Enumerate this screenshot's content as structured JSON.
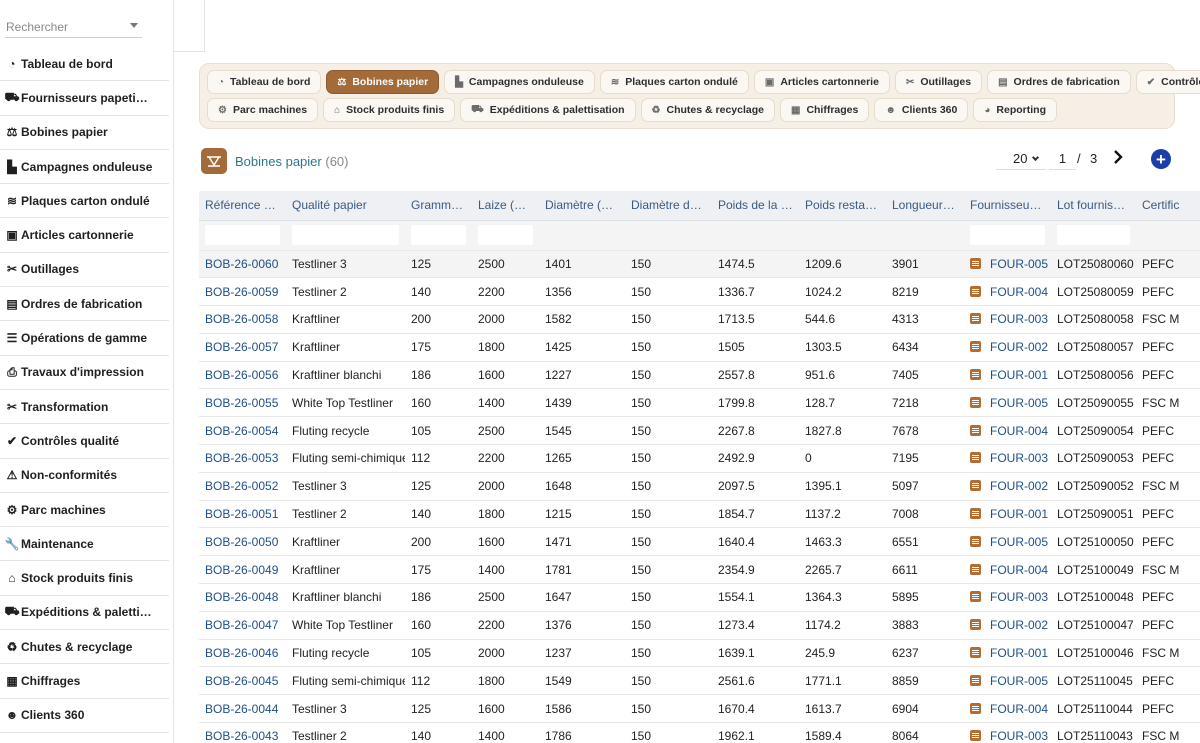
{
  "search": {
    "placeholder": "Rechercher"
  },
  "sidebar": {
    "items": [
      {
        "label": "Tableau de bord",
        "icon": "dashboard-icon"
      },
      {
        "label": "Fournisseurs papeti…",
        "icon": "truck-icon"
      },
      {
        "label": "Bobines papier",
        "icon": "paper-roll-icon"
      },
      {
        "label": "Campagnes onduleuse",
        "icon": "factory-icon"
      },
      {
        "label": "Plaques carton ondulé",
        "icon": "layers-icon"
      },
      {
        "label": "Articles cartonnerie",
        "icon": "box-icon"
      },
      {
        "label": "Outillages",
        "icon": "tools-icon"
      },
      {
        "label": "Ordres de fabrication",
        "icon": "clipboard-icon"
      },
      {
        "label": "Opérations de gamme",
        "icon": "list-icon"
      },
      {
        "label": "Travaux d'impression",
        "icon": "printer-icon"
      },
      {
        "label": "Transformation",
        "icon": "scissors-icon"
      },
      {
        "label": "Contrôles qualité",
        "icon": "check-circle-icon"
      },
      {
        "label": "Non-conformités",
        "icon": "warning-icon"
      },
      {
        "label": "Parc machines",
        "icon": "gears-icon"
      },
      {
        "label": "Maintenance",
        "icon": "wrench-icon"
      },
      {
        "label": "Stock produits finis",
        "icon": "warehouse-icon"
      },
      {
        "label": "Expéditions & paletti…",
        "icon": "truck-icon"
      },
      {
        "label": "Chutes & recyclage",
        "icon": "recycle-icon"
      },
      {
        "label": "Chiffrages",
        "icon": "calculator-icon"
      },
      {
        "label": "Clients 360",
        "icon": "users-icon"
      },
      {
        "label": "",
        "icon": ""
      }
    ]
  },
  "modules": {
    "row1": [
      {
        "label": "Tableau de bord",
        "icon": "dashboard-icon",
        "active": false
      },
      {
        "label": "Bobines papier",
        "icon": "paper-roll-icon",
        "active": true
      },
      {
        "label": "Campagnes onduleuse",
        "icon": "factory-icon",
        "active": false
      },
      {
        "label": "Plaques carton ondulé",
        "icon": "layers-icon",
        "active": false
      },
      {
        "label": "Articles cartonnerie",
        "icon": "box-icon",
        "active": false
      },
      {
        "label": "Outillages",
        "icon": "tools-icon",
        "active": false
      },
      {
        "label": "Ordres de fabrication",
        "icon": "clipboard-icon",
        "active": false
      },
      {
        "label": "Contrôles qualité",
        "icon": "check-circle-icon",
        "active": false
      }
    ],
    "row2": [
      {
        "label": "Parc machines",
        "icon": "gears-icon",
        "active": false
      },
      {
        "label": "Stock produits finis",
        "icon": "warehouse-icon",
        "active": false
      },
      {
        "label": "Expéditions & palettisation",
        "icon": "truck-icon",
        "active": false
      },
      {
        "label": "Chutes & recyclage",
        "icon": "recycle-icon",
        "active": false
      },
      {
        "label": "Chiffrages",
        "icon": "calculator-icon",
        "active": false
      },
      {
        "label": "Clients 360",
        "icon": "users-icon",
        "active": false
      },
      {
        "label": "Reporting",
        "icon": "pie-chart-icon",
        "active": false
      }
    ]
  },
  "page": {
    "title": "Bobines papier",
    "count": "(60)",
    "page_size": "20",
    "page": "1",
    "slash": "/",
    "total_pages": "3"
  },
  "colors": {
    "accent": "#a36b3a",
    "link": "#1f4f8a",
    "add": "#1a3fa8",
    "title": "#2b7a8c"
  },
  "table": {
    "columns": [
      "Référence b…",
      "Qualité papier",
      "Grammage",
      "Laize (mm)",
      "Diamètre (mm)",
      "Diamètre du …",
      "Poids de la b…",
      "Poids restan…",
      "Longueur (m)",
      "Fournisseur …",
      "Lot fournisseur",
      "Certific"
    ],
    "rows": [
      [
        "BOB-26-0060",
        "Testliner 3",
        "125",
        "2500",
        "1401",
        "150",
        "1474.5",
        "1209.6",
        "3901",
        "FOUR-005",
        "LOT25080060",
        "PEFC"
      ],
      [
        "BOB-26-0059",
        "Testliner 2",
        "140",
        "2200",
        "1356",
        "150",
        "1336.7",
        "1024.2",
        "8219",
        "FOUR-004",
        "LOT25080059",
        "PEFC"
      ],
      [
        "BOB-26-0058",
        "Kraftliner",
        "200",
        "2000",
        "1582",
        "150",
        "1713.5",
        "544.6",
        "4313",
        "FOUR-003",
        "LOT25080058",
        "FSC M"
      ],
      [
        "BOB-26-0057",
        "Kraftliner",
        "175",
        "1800",
        "1425",
        "150",
        "1505",
        "1303.5",
        "6434",
        "FOUR-002",
        "LOT25080057",
        "PEFC"
      ],
      [
        "BOB-26-0056",
        "Kraftliner blanchi",
        "186",
        "1600",
        "1227",
        "150",
        "2557.8",
        "951.6",
        "7405",
        "FOUR-001",
        "LOT25080056",
        "PEFC"
      ],
      [
        "BOB-26-0055",
        "White Top Testliner",
        "160",
        "1400",
        "1439",
        "150",
        "1799.8",
        "128.7",
        "7218",
        "FOUR-005",
        "LOT25090055",
        "FSC M"
      ],
      [
        "BOB-26-0054",
        "Fluting recycle",
        "105",
        "2500",
        "1545",
        "150",
        "2267.8",
        "1827.8",
        "7678",
        "FOUR-004",
        "LOT25090054",
        "PEFC"
      ],
      [
        "BOB-26-0053",
        "Fluting semi-chimique",
        "112",
        "2200",
        "1265",
        "150",
        "2492.9",
        "0",
        "7195",
        "FOUR-003",
        "LOT25090053",
        "PEFC"
      ],
      [
        "BOB-26-0052",
        "Testliner 3",
        "125",
        "2000",
        "1648",
        "150",
        "2097.5",
        "1395.1",
        "5097",
        "FOUR-002",
        "LOT25090052",
        "FSC M"
      ],
      [
        "BOB-26-0051",
        "Testliner 2",
        "140",
        "1800",
        "1215",
        "150",
        "1854.7",
        "1137.2",
        "7008",
        "FOUR-001",
        "LOT25090051",
        "PEFC"
      ],
      [
        "BOB-26-0050",
        "Kraftliner",
        "200",
        "1600",
        "1471",
        "150",
        "1640.4",
        "1463.3",
        "6551",
        "FOUR-005",
        "LOT25100050",
        "PEFC"
      ],
      [
        "BOB-26-0049",
        "Kraftliner",
        "175",
        "1400",
        "1781",
        "150",
        "2354.9",
        "2265.7",
        "6611",
        "FOUR-004",
        "LOT25100049",
        "FSC M"
      ],
      [
        "BOB-26-0048",
        "Kraftliner blanchi",
        "186",
        "2500",
        "1647",
        "150",
        "1554.1",
        "1364.3",
        "5895",
        "FOUR-003",
        "LOT25100048",
        "PEFC"
      ],
      [
        "BOB-26-0047",
        "White Top Testliner",
        "160",
        "2200",
        "1376",
        "150",
        "1273.4",
        "1174.2",
        "3883",
        "FOUR-002",
        "LOT25100047",
        "PEFC"
      ],
      [
        "BOB-26-0046",
        "Fluting recycle",
        "105",
        "2000",
        "1237",
        "150",
        "1639.1",
        "245.9",
        "6237",
        "FOUR-001",
        "LOT25100046",
        "FSC M"
      ],
      [
        "BOB-26-0045",
        "Fluting semi-chimique",
        "112",
        "1800",
        "1549",
        "150",
        "2561.6",
        "1771.1",
        "8859",
        "FOUR-005",
        "LOT25110045",
        "PEFC"
      ],
      [
        "BOB-26-0044",
        "Testliner 3",
        "125",
        "1600",
        "1586",
        "150",
        "1670.4",
        "1613.7",
        "6904",
        "FOUR-004",
        "LOT25110044",
        "PEFC"
      ],
      [
        "BOB-26-0043",
        "Testliner 2",
        "140",
        "1400",
        "1786",
        "150",
        "1962.1",
        "1589.4",
        "8064",
        "FOUR-003",
        "LOT25110043",
        "FSC M"
      ]
    ]
  }
}
